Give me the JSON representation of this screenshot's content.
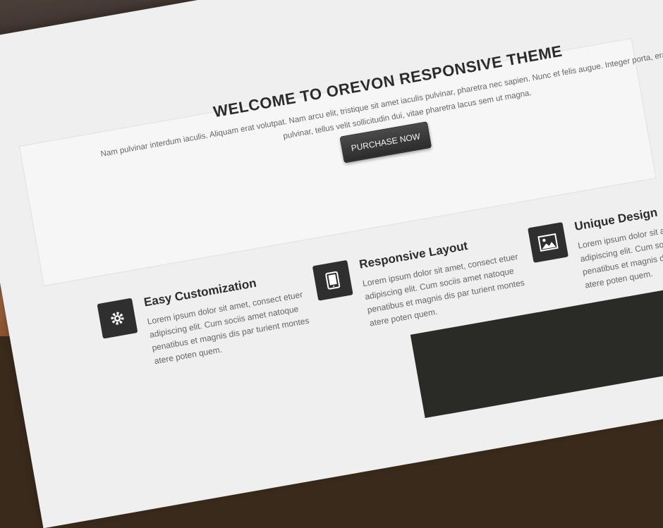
{
  "slider": {
    "dots": 4,
    "active_index": 0
  },
  "welcome": {
    "title": "WELCOME TO OREVON RESPONSIVE THEME",
    "text": "Nam pulvinar interdum iaculis. Aliquam erat volutpat. Nam arcu elit, tristique sit amet iaculis pulvinar, pharetra nec sapien. Nunc et felis augue. Integer porta, erat sed rutrum pulvinar, tellus velit sollicitudin dui, vitae pharetra lacus sem ut magna.",
    "button_label": "PURCHASE NOW"
  },
  "features": [
    {
      "title": "Easy Customization",
      "text": "Lorem ipsum dolor sit amet, consect etuer adipiscing elit. Cum sociis amet natoque penatibus et magnis dis par turient montes atere poten quem.",
      "icon": "gear-icon"
    },
    {
      "title": "Responsive Layout",
      "text": "Lorem ipsum dolor sit amet, consect etuer adipiscing elit. Cum sociis amet natoque penatibus et magnis dis par turient montes atere poten quem.",
      "icon": "tablet-icon"
    },
    {
      "title": "Unique Design",
      "text": "Lorem ipsum dolor sit amet, consect etuer adipiscing elit. Cum sociis amet natoque penatibus et magnis dis par turient montes atere poten quem.",
      "icon": "image-icon"
    }
  ],
  "colors": {
    "dark": "#2f2f2f",
    "page": "#efefef",
    "wood": "#a45c2c"
  }
}
